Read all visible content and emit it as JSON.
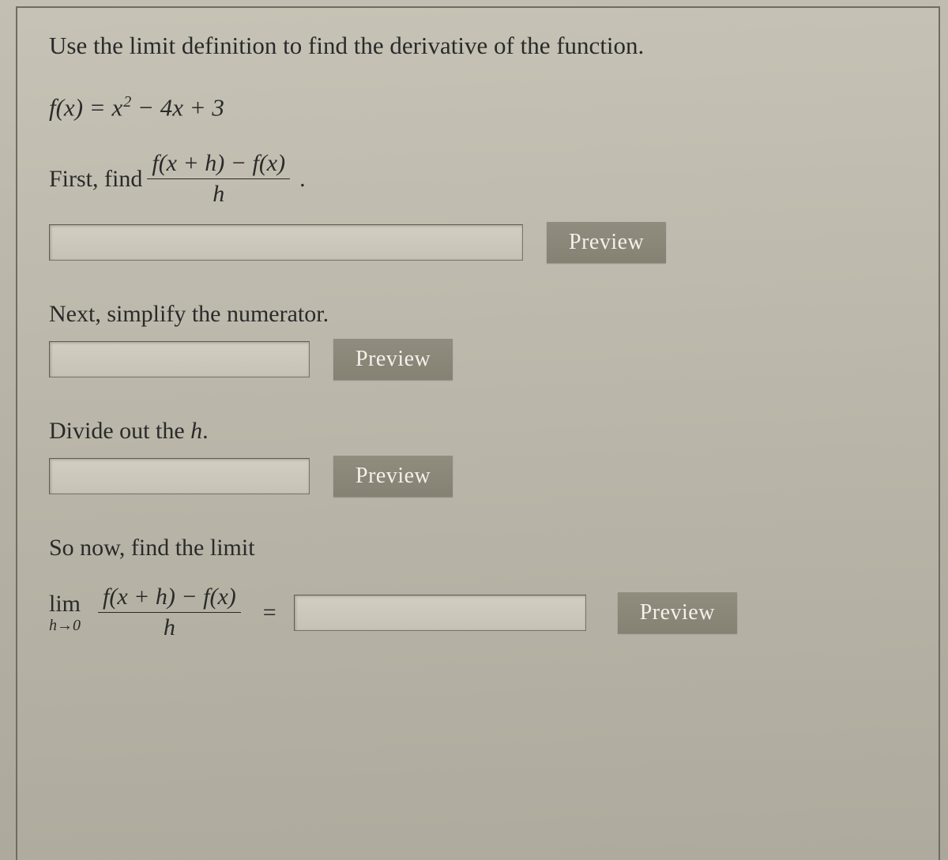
{
  "prompt": "Use the limit definition to find the derivative of the function.",
  "function": {
    "fx_lhs": "f(x) = ",
    "fx_rhs_x": "x",
    "fx_rhs_sq": "2",
    "fx_rhs_rest": " − 4x + 3"
  },
  "step1": {
    "prefix": "First, find ",
    "diffq_num": "f(x + h) − f(x)",
    "diffq_den": "h",
    "period": ".",
    "input_value": "",
    "preview_label": "Preview"
  },
  "step2": {
    "label": "Next, simplify the numerator.",
    "input_value": "",
    "preview_label": "Preview"
  },
  "step3": {
    "label_pre": "Divide out the ",
    "label_h": "h",
    "label_post": ".",
    "input_value": "",
    "preview_label": "Preview"
  },
  "step4": {
    "label": "So now, find the limit",
    "lim_word": "lim",
    "lim_sub": "h→0",
    "diffq_num": "f(x + h) − f(x)",
    "diffq_den": "h",
    "equals": "=",
    "input_value": "",
    "preview_label": "Preview"
  }
}
